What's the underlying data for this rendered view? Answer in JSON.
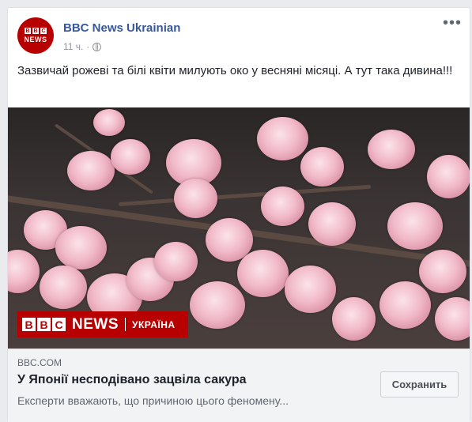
{
  "post": {
    "page_name": "BBC News Ukrainian",
    "time": "11 ч.",
    "separator": "·",
    "privacy_icon": "globe-icon",
    "more_icon": "ellipsis-icon",
    "more_label": "•••",
    "avatar": {
      "blocks": [
        "B",
        "B",
        "C"
      ],
      "label": "NEWS"
    },
    "text": "Зазвичай рожеві та білі квіти милують око у весняні місяці. А тут така дивина!!!"
  },
  "image": {
    "logo_blocks": [
      "B",
      "B",
      "C"
    ],
    "logo_news": "NEWS",
    "logo_region": "УКРАЇНА"
  },
  "link": {
    "domain": "BBC.COM",
    "headline": "У Японії несподівано зацвіла сакура",
    "description": "Експерти вважають, що причиною цього феномену...",
    "save_label": "Сохранить"
  },
  "colors": {
    "brand": "#b80000",
    "link": "#365899",
    "page_bg": "#e9ebee"
  }
}
